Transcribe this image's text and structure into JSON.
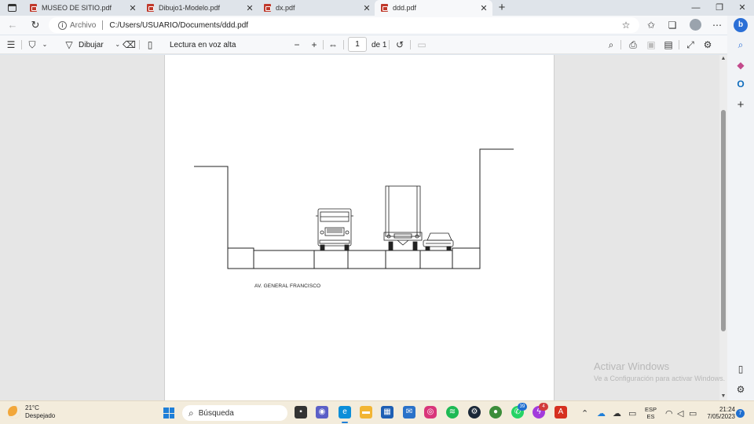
{
  "tabs": [
    {
      "title": "MUSEO DE SITIO.pdf",
      "active": false
    },
    {
      "title": "Dibujo1-Modelo.pdf",
      "active": false
    },
    {
      "title": "dx.pdf",
      "active": false
    },
    {
      "title": "ddd.pdf",
      "active": true
    }
  ],
  "address": {
    "scheme_label": "Archivo",
    "path": "C:/Users/USUARIO/Documents/ddd.pdf"
  },
  "pdf_toolbar": {
    "draw_label": "Dibujar",
    "read_aloud_label": "Lectura en voz alta",
    "page_current": "1",
    "page_total_label": "de 1"
  },
  "document": {
    "street_label": "AV. GENERAL FRANCISCO"
  },
  "watermark": {
    "line1": "Activar Windows",
    "line2": "Ve a Configuración para activar Windows."
  },
  "taskbar": {
    "weather_temp": "21°C",
    "weather_desc": "Despejado",
    "search_label": "Búsqueda",
    "badge_whatsapp": "39",
    "badge_messenger": "4",
    "lang_line1": "ESP",
    "lang_line2": "ES",
    "time": "21:24",
    "date": "7/05/2023",
    "notification_count": "7"
  },
  "colors": {
    "pdf_icon": "#c0392b",
    "accent": "#1f7fd8",
    "taskbar_bg": "#f3ecdc"
  }
}
